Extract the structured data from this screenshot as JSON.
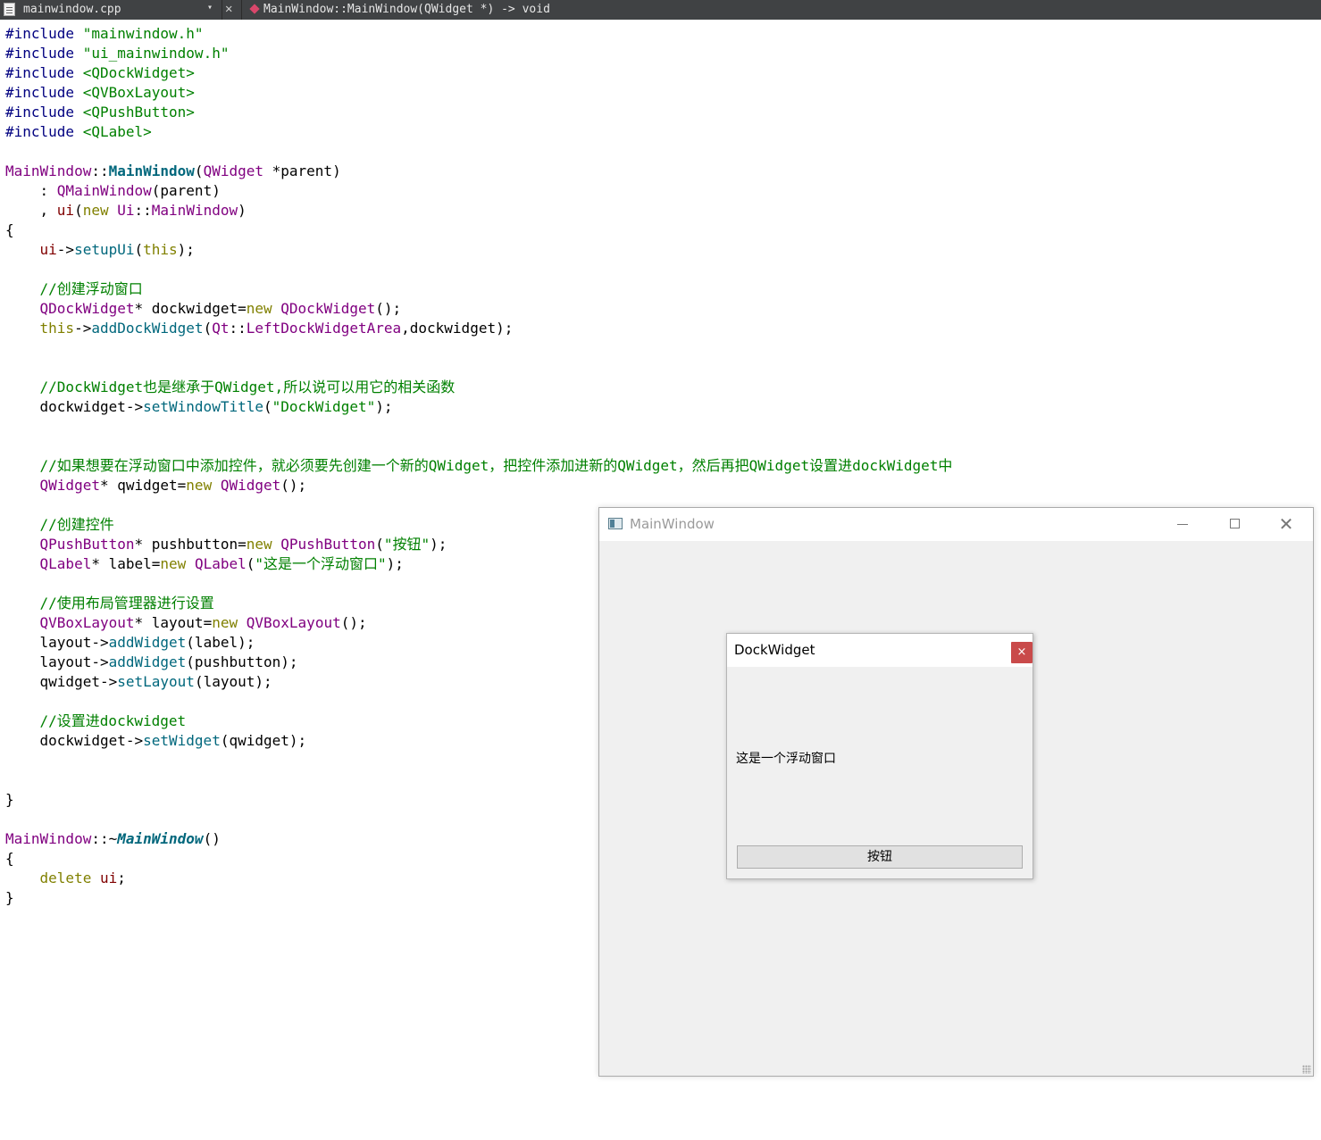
{
  "editor": {
    "file_name": "mainwindow.cpp",
    "dropdown_glyph": "▾",
    "close_glyph": "✕",
    "symbol": "MainWindow::MainWindow(QWidget *) -> void"
  },
  "code": {
    "lines": [
      [
        [
          "pp",
          "#include "
        ],
        [
          "str",
          "\"mainwindow.h\""
        ]
      ],
      [
        [
          "pp",
          "#include "
        ],
        [
          "str",
          "\"ui_mainwindow.h\""
        ]
      ],
      [
        [
          "pp",
          "#include "
        ],
        [
          "str",
          "<QDockWidget>"
        ]
      ],
      [
        [
          "pp",
          "#include "
        ],
        [
          "str",
          "<QVBoxLayout>"
        ]
      ],
      [
        [
          "pp",
          "#include "
        ],
        [
          "str",
          "<QPushButton>"
        ]
      ],
      [
        [
          "pp",
          "#include "
        ],
        [
          "str",
          "<QLabel>"
        ]
      ],
      [],
      [
        [
          "cls",
          "MainWindow"
        ],
        [
          "",
          "::"
        ],
        [
          "fnb",
          "MainWindow"
        ],
        [
          "",
          "("
        ],
        [
          "cls",
          "QWidget"
        ],
        [
          "",
          " *parent)"
        ]
      ],
      [
        [
          "",
          "    : "
        ],
        [
          "cls",
          "QMainWindow"
        ],
        [
          "",
          "(parent)"
        ]
      ],
      [
        [
          "",
          "    , "
        ],
        [
          "mem",
          "ui"
        ],
        [
          "",
          "("
        ],
        [
          "kw",
          "new"
        ],
        [
          "",
          " "
        ],
        [
          "cls",
          "Ui"
        ],
        [
          "",
          "::"
        ],
        [
          "cls",
          "MainWindow"
        ],
        [
          "",
          ")"
        ]
      ],
      [
        [
          "",
          "{"
        ]
      ],
      [
        [
          "",
          "    "
        ],
        [
          "mem",
          "ui"
        ],
        [
          "",
          "->"
        ],
        [
          "fn",
          "setupUi"
        ],
        [
          "",
          "("
        ],
        [
          "kw",
          "this"
        ],
        [
          "",
          ");"
        ]
      ],
      [],
      [
        [
          "",
          "    "
        ],
        [
          "cm",
          "//创建浮动窗口"
        ]
      ],
      [
        [
          "",
          "    "
        ],
        [
          "cls",
          "QDockWidget"
        ],
        [
          "",
          "* dockwidget="
        ],
        [
          "kw",
          "new"
        ],
        [
          "",
          " "
        ],
        [
          "cls",
          "QDockWidget"
        ],
        [
          "",
          "();"
        ]
      ],
      [
        [
          "",
          "    "
        ],
        [
          "kw",
          "this"
        ],
        [
          "",
          "->"
        ],
        [
          "fn",
          "addDockWidget"
        ],
        [
          "",
          "("
        ],
        [
          "cls",
          "Qt"
        ],
        [
          "",
          "::"
        ],
        [
          "en",
          "LeftDockWidgetArea"
        ],
        [
          "",
          ",dockwidget);"
        ]
      ],
      [],
      [],
      [
        [
          "",
          "    "
        ],
        [
          "cm",
          "//DockWidget也是继承于QWidget,所以说可以用它的相关函数"
        ]
      ],
      [
        [
          "",
          "    dockwidget->"
        ],
        [
          "fn",
          "setWindowTitle"
        ],
        [
          "",
          "("
        ],
        [
          "str",
          "\"DockWidget\""
        ],
        [
          "",
          ");"
        ]
      ],
      [],
      [],
      [
        [
          "",
          "    "
        ],
        [
          "cm",
          "//如果想要在浮动窗口中添加控件，就必须要先创建一个新的QWidget，把控件添加进新的QWidget，然后再把QWidget设置进dockWidget中"
        ]
      ],
      [
        [
          "",
          "    "
        ],
        [
          "cls",
          "QWidget"
        ],
        [
          "",
          "* qwidget="
        ],
        [
          "kw",
          "new"
        ],
        [
          "",
          " "
        ],
        [
          "cls",
          "QWidget"
        ],
        [
          "",
          "();"
        ]
      ],
      [],
      [
        [
          "",
          "    "
        ],
        [
          "cm",
          "//创建控件"
        ]
      ],
      [
        [
          "",
          "    "
        ],
        [
          "cls",
          "QPushButton"
        ],
        [
          "",
          "* pushbutton="
        ],
        [
          "kw",
          "new"
        ],
        [
          "",
          " "
        ],
        [
          "cls",
          "QPushButton"
        ],
        [
          "",
          "("
        ],
        [
          "str",
          "\"按钮\""
        ],
        [
          "",
          ");"
        ]
      ],
      [
        [
          "",
          "    "
        ],
        [
          "cls",
          "QLabel"
        ],
        [
          "",
          "* label="
        ],
        [
          "kw",
          "new"
        ],
        [
          "",
          " "
        ],
        [
          "cls",
          "QLabel"
        ],
        [
          "",
          "("
        ],
        [
          "str",
          "\"这是一个浮动窗口\""
        ],
        [
          "",
          ");"
        ]
      ],
      [],
      [
        [
          "",
          "    "
        ],
        [
          "cm",
          "//使用布局管理器进行设置"
        ]
      ],
      [
        [
          "",
          "    "
        ],
        [
          "cls",
          "QVBoxLayout"
        ],
        [
          "",
          "* layout="
        ],
        [
          "kw",
          "new"
        ],
        [
          "",
          " "
        ],
        [
          "cls",
          "QVBoxLayout"
        ],
        [
          "",
          "();"
        ]
      ],
      [
        [
          "",
          "    layout->"
        ],
        [
          "fn",
          "addWidget"
        ],
        [
          "",
          "(label);"
        ]
      ],
      [
        [
          "",
          "    layout->"
        ],
        [
          "fn",
          "addWidget"
        ],
        [
          "",
          "(pushbutton);"
        ]
      ],
      [
        [
          "",
          "    qwidget->"
        ],
        [
          "fn",
          "setLayout"
        ],
        [
          "",
          "(layout);"
        ]
      ],
      [],
      [
        [
          "",
          "    "
        ],
        [
          "cm",
          "//设置进dockwidget"
        ]
      ],
      [
        [
          "",
          "    dockwidget->"
        ],
        [
          "fn",
          "setWidget"
        ],
        [
          "",
          "(qwidget);"
        ]
      ],
      [],
      [],
      [
        [
          "",
          "}"
        ]
      ],
      [],
      [
        [
          "cls",
          "MainWindow"
        ],
        [
          "",
          "::~"
        ],
        [
          "fni",
          "MainWindow"
        ],
        [
          "",
          "()"
        ]
      ],
      [
        [
          "",
          "{"
        ]
      ],
      [
        [
          "",
          "    "
        ],
        [
          "kw",
          "delete"
        ],
        [
          "",
          " "
        ],
        [
          "mem",
          "ui"
        ],
        [
          "",
          ";"
        ]
      ],
      [
        [
          "",
          "}"
        ]
      ]
    ]
  },
  "app_window": {
    "title": "MainWindow",
    "close_glyph": "✕"
  },
  "dock_widget": {
    "title": "DockWidget",
    "close_glyph": "×",
    "label": "这是一个浮动窗口",
    "button_label": "按钮"
  }
}
